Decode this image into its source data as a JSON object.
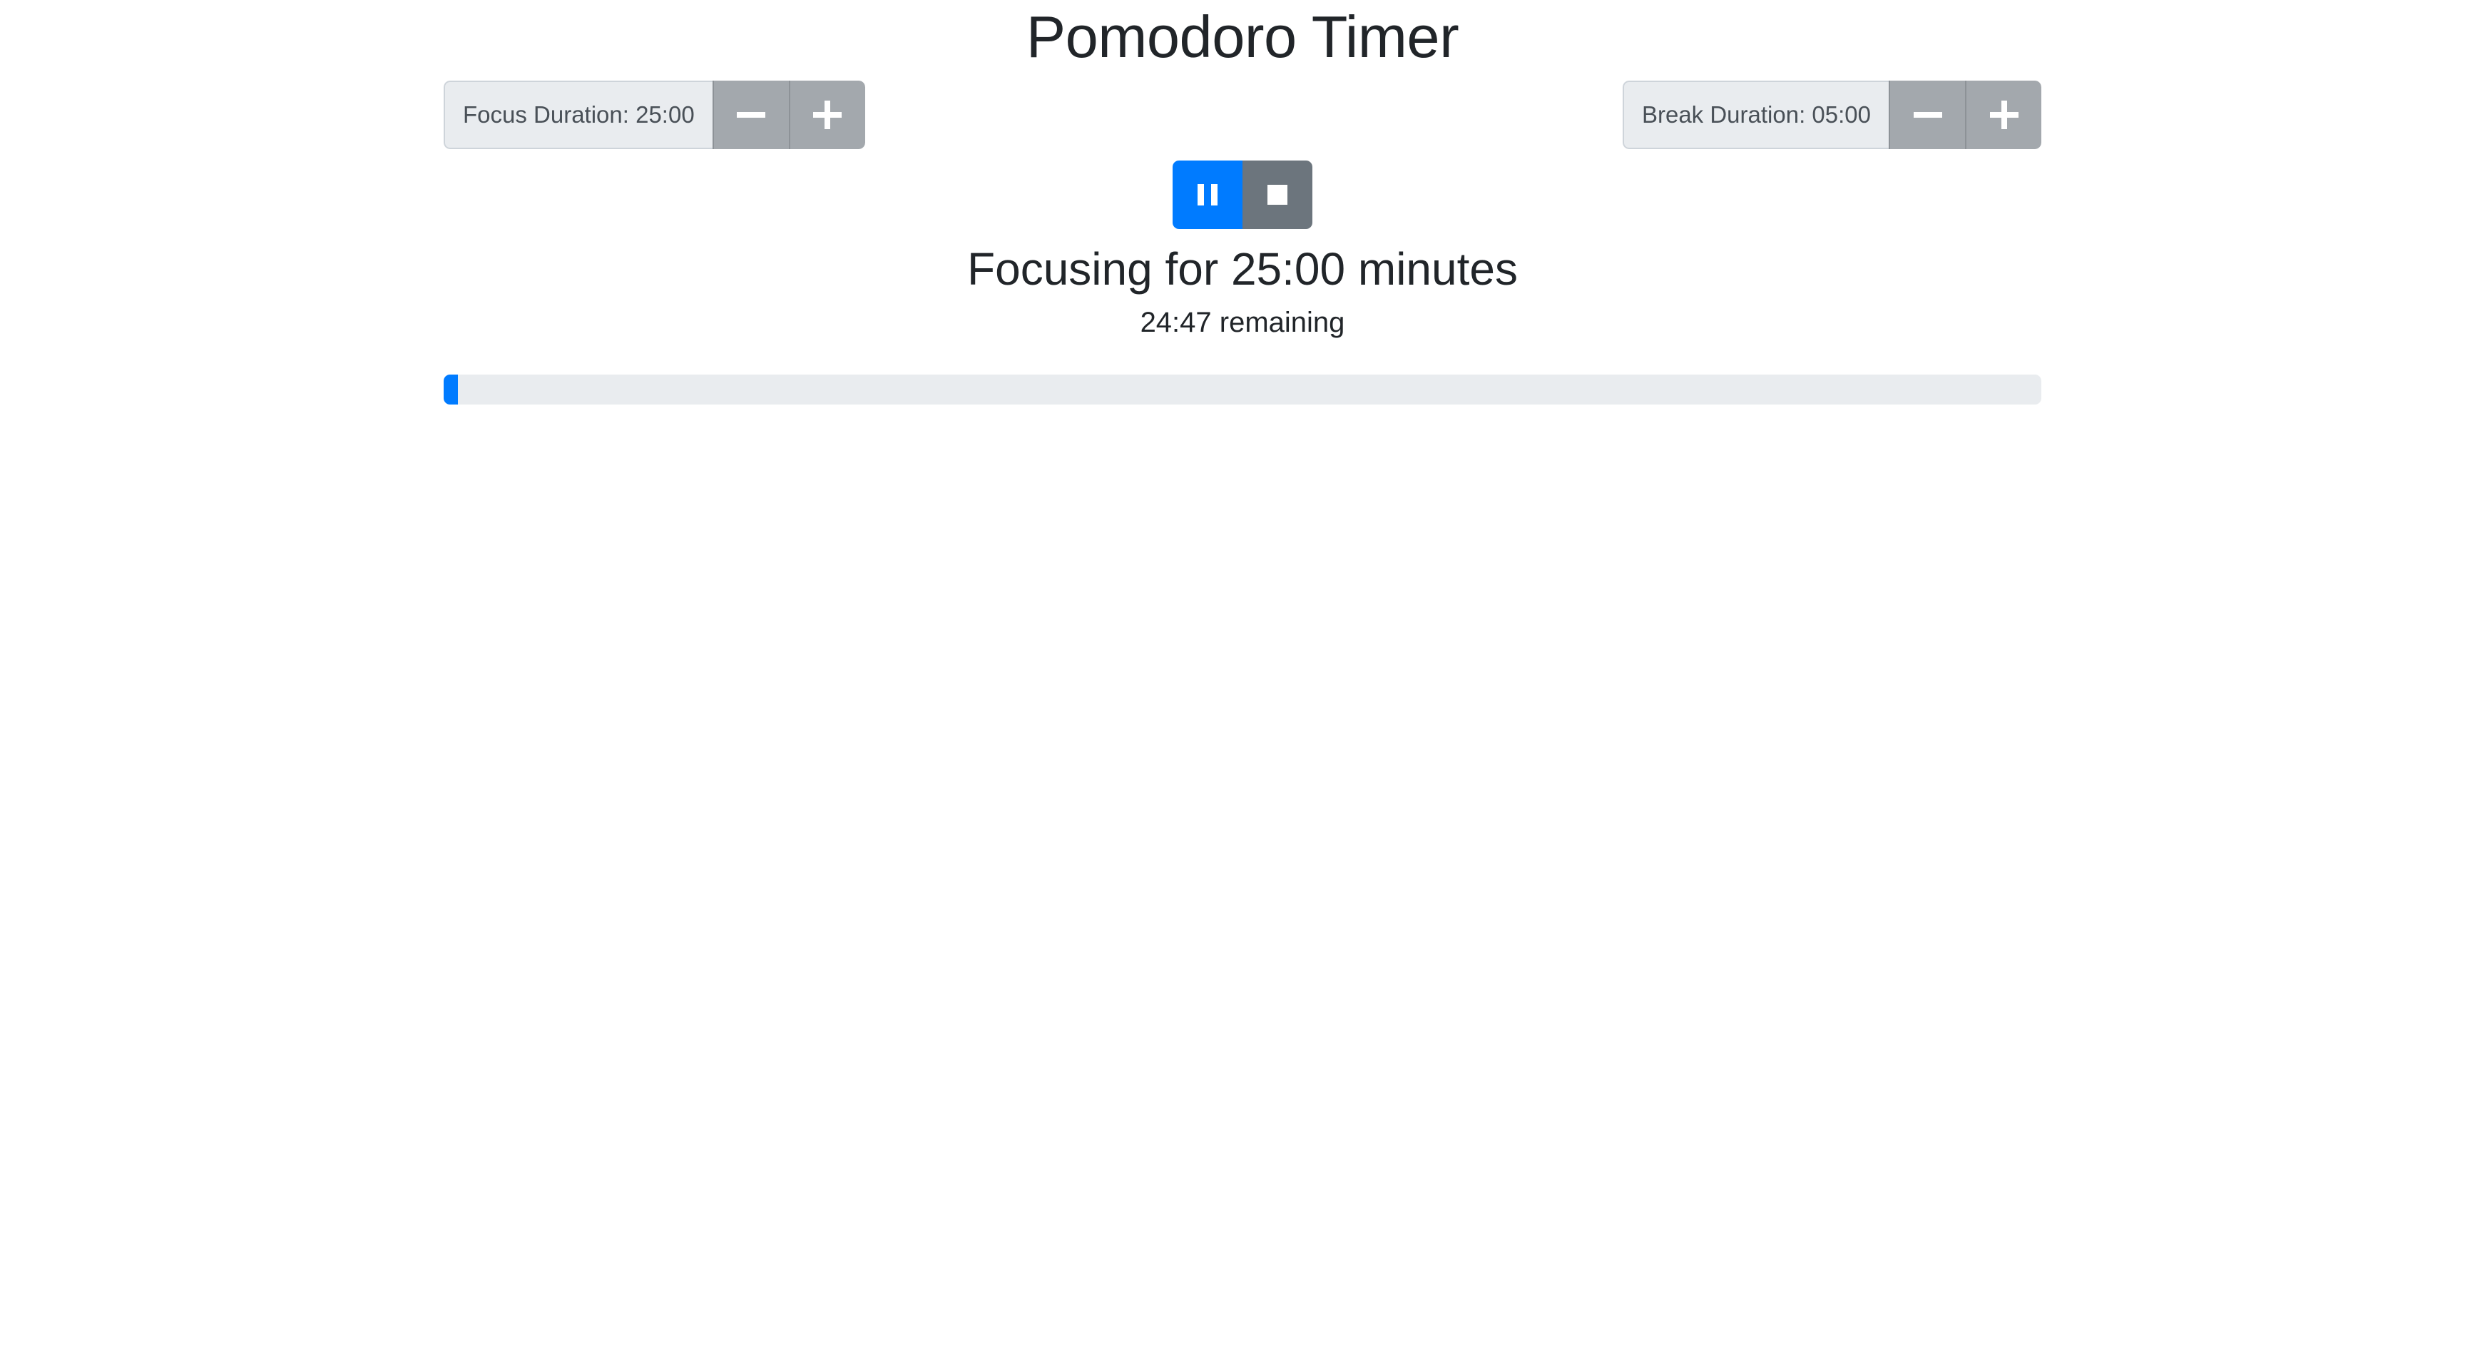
{
  "title": "Pomodoro Timer",
  "focus": {
    "label": "Focus Duration: 25:00",
    "decrement_icon": "minus-icon",
    "increment_icon": "plus-icon"
  },
  "break": {
    "label": "Break Duration: 05:00",
    "decrement_icon": "minus-icon",
    "increment_icon": "plus-icon"
  },
  "controls": {
    "pause_icon": "pause-icon",
    "stop_icon": "stop-icon"
  },
  "status": "Focusing for 25:00 minutes",
  "remaining": "24:47 remaining",
  "progress": {
    "percent": 0.9
  },
  "colors": {
    "primary": "#007bff",
    "secondary": "#6c757d",
    "addon_button": "#a3a8ad",
    "addon_label_bg": "#e9ecef",
    "progress_track": "#e9ecef"
  }
}
